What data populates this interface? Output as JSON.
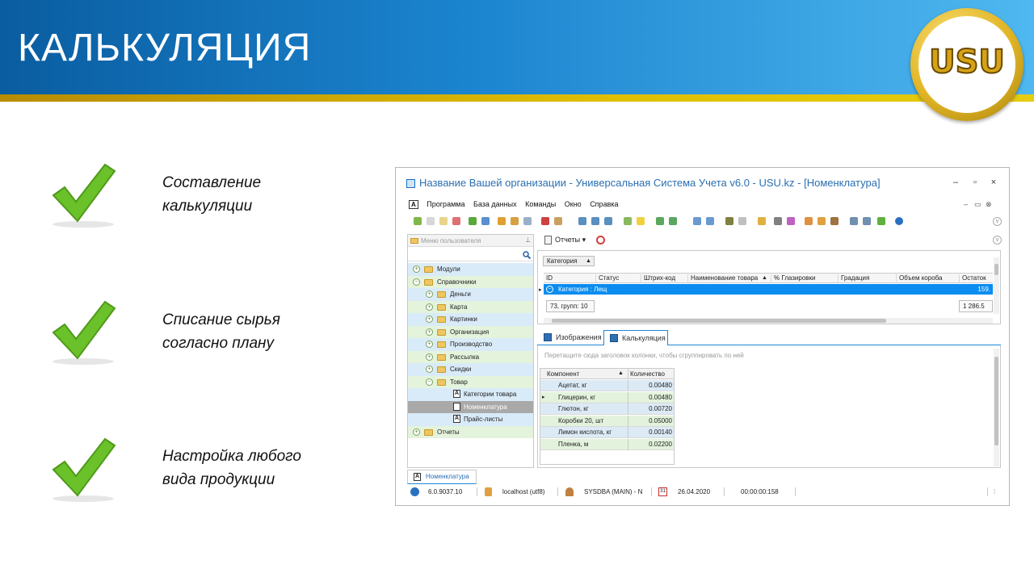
{
  "slide": {
    "title": "КАЛЬКУЛЯЦИЯ",
    "logo_text": "USU",
    "colors": {
      "header_blue": "#1b84cf",
      "stripe_gold": "#d4b000",
      "check_green": "#6ac12a"
    }
  },
  "features": [
    {
      "line1": "Составление",
      "line2": "калькуляции"
    },
    {
      "line1": "Списание сырья",
      "line2": "согласно плану"
    },
    {
      "line1": "Настройка любого",
      "line2": "вида продукции"
    }
  ],
  "window": {
    "title": "Название Вашей организации - Универсальная Система Учета v6.0 - USU.kz - [Номенклатура]",
    "controls": {
      "minimize": "–",
      "maximize": "▫",
      "close": "×"
    },
    "doc_controls": {
      "minimize": "–",
      "restore": "▭",
      "close": "⊗"
    },
    "menu_icon": "A",
    "menu": [
      "Программа",
      "База данных",
      "Команды",
      "Окно",
      "Справка"
    ],
    "left_panel": {
      "title": "Меню пользователя",
      "pin": "⊥",
      "tree": [
        {
          "label": "Модули",
          "exp": "+",
          "level": 0,
          "kind": "folder",
          "bg": "blue"
        },
        {
          "label": "Справочники",
          "exp": "−",
          "level": 0,
          "kind": "folder",
          "bg": "green"
        },
        {
          "label": "Деньги",
          "exp": "+",
          "level": 1,
          "kind": "folder",
          "bg": "blue"
        },
        {
          "label": "Карта",
          "exp": "+",
          "level": 1,
          "kind": "folder",
          "bg": "green"
        },
        {
          "label": "Картинки",
          "exp": "+",
          "level": 1,
          "kind": "folder",
          "bg": "blue"
        },
        {
          "label": "Организация",
          "exp": "+",
          "level": 1,
          "kind": "folder",
          "bg": "green"
        },
        {
          "label": "Производство",
          "exp": "+",
          "level": 1,
          "kind": "folder",
          "bg": "blue"
        },
        {
          "label": "Рассылка",
          "exp": "+",
          "level": 1,
          "kind": "folder",
          "bg": "green"
        },
        {
          "label": "Скидки",
          "exp": "+",
          "level": 1,
          "kind": "folder",
          "bg": "blue"
        },
        {
          "label": "Товар",
          "exp": "−",
          "level": 1,
          "kind": "folder",
          "bg": "green"
        },
        {
          "label": "Категории товара",
          "exp": "",
          "level": 2,
          "kind": "doc",
          "bg": "blue"
        },
        {
          "label": "Номенклатура",
          "exp": "",
          "level": 2,
          "kind": "doc",
          "bg": "sel"
        },
        {
          "label": "Прайс-листы",
          "exp": "",
          "level": 2,
          "kind": "doc",
          "bg": "blue"
        },
        {
          "label": "Отчеты",
          "exp": "+",
          "level": 0,
          "kind": "folder",
          "bg": "green"
        }
      ]
    },
    "right_toolbar": {
      "reports_label": "Отчеты"
    },
    "grid": {
      "group_label": "Категория",
      "columns": [
        "ID",
        "Статус",
        "Штрих-код",
        "Наименование товара",
        "% Глазировки",
        "Градация",
        "Объем короба",
        "Остаток"
      ],
      "selected_row": "Категория : Лещ",
      "selected_value": "159.",
      "summary_left": "73, групп: 10",
      "summary_right": "1 286.5"
    },
    "tabs": [
      "Изображения",
      "Калькуляция"
    ],
    "detail": {
      "drag_hint": "Перетащите сюда заголовок колонки, чтобы сгруппировать по ней",
      "columns": [
        "Компонент",
        "Количество"
      ],
      "rows": [
        {
          "name": "Ацетат, кг",
          "qty": "0.00480"
        },
        {
          "name": "Глицерин, кг",
          "qty": "0.00480"
        },
        {
          "name": "Глютон, кг",
          "qty": "0.00720"
        },
        {
          "name": "Коробки 20, шт",
          "qty": "0.05000"
        },
        {
          "name": "Лимон кислота, кг",
          "qty": "0.00140"
        },
        {
          "name": "Пленка, м",
          "qty": "0.02200"
        }
      ]
    },
    "bottom_tab": "Номенклатура",
    "status": {
      "version": "6.0.9037.10",
      "db": "localhost (utf8)",
      "user": "SYSDBA (MAIN) - N",
      "date_icon": "31",
      "date": "26.04.2020",
      "timer": "00:00:00:158"
    }
  }
}
